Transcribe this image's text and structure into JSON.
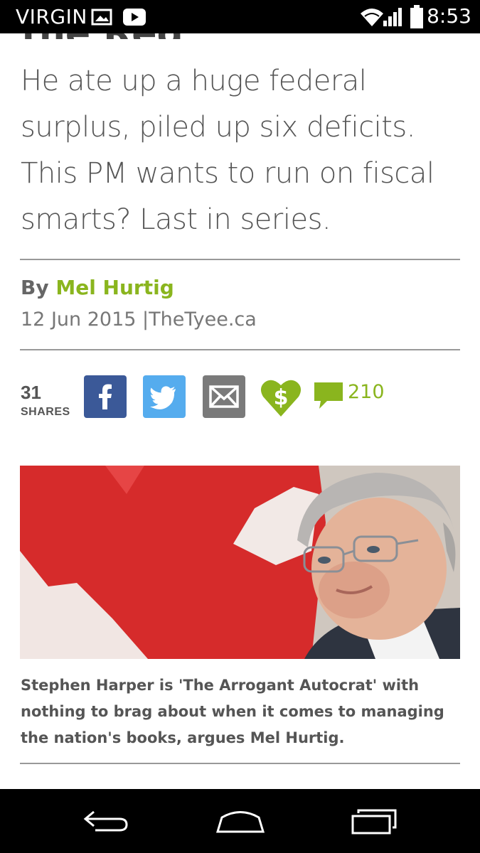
{
  "status_bar": {
    "carrier": "VIRGIN",
    "time": "8:53"
  },
  "article": {
    "clipped_title": "the Red",
    "deck": "He ate up a huge federal surplus, piled up six deficits. This PM wants to run on fiscal smarts? Last in series.",
    "byline_prefix": "By",
    "author": "Mel Hurtig",
    "date": "12 Jun 2015",
    "separator": "|",
    "source": "TheTyee.ca"
  },
  "share": {
    "count": "31",
    "label": "SHARES",
    "comment_count": "210"
  },
  "photo": {
    "caption": "Stephen Harper is 'The Arrogant Autocrat' with nothing to brag about when it comes to managing the nation's books, argues Mel Hurtig."
  },
  "colors": {
    "accent_green": "#8ab51e",
    "facebook": "#3b5998",
    "twitter": "#55acee",
    "email": "#7a7a7a",
    "flag_red": "#d62b2b"
  },
  "icons": [
    "picture-icon",
    "youtube-icon",
    "wifi-icon",
    "signal-icon",
    "battery-icon",
    "facebook-icon",
    "twitter-icon",
    "email-icon",
    "donate-heart-icon",
    "comment-icon",
    "back-icon",
    "home-icon",
    "recents-icon"
  ]
}
